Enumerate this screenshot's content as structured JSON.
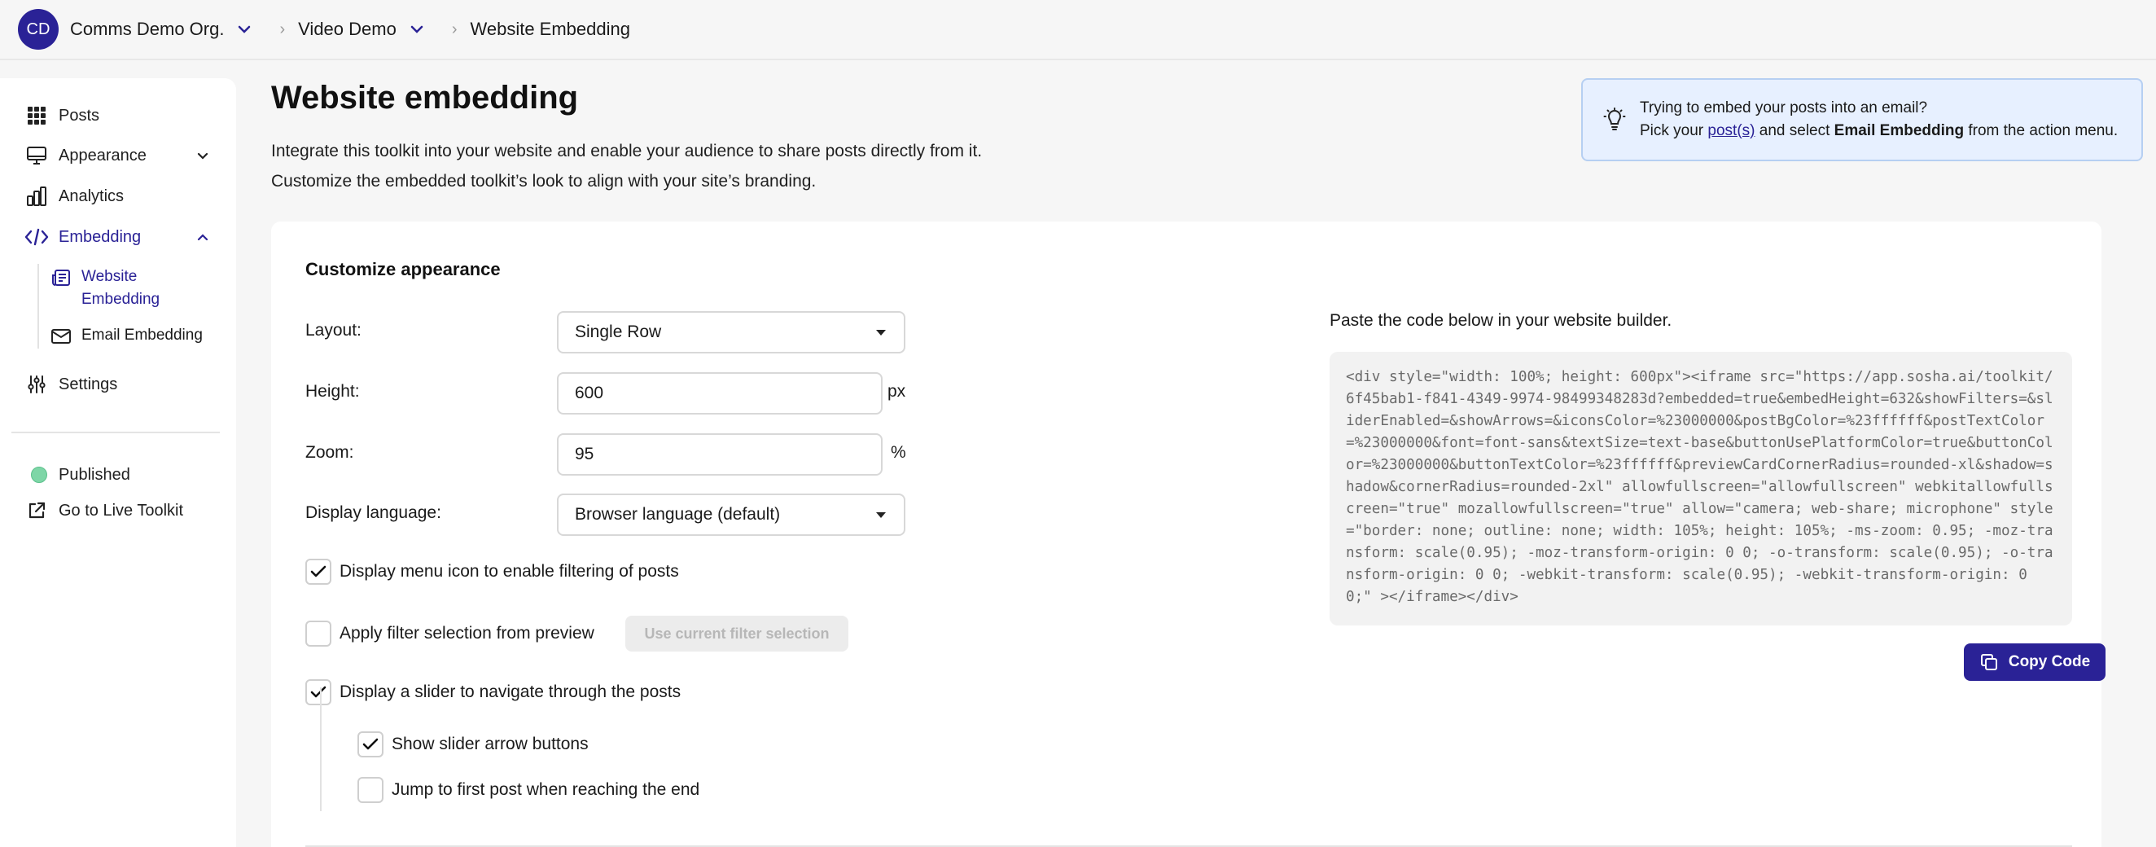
{
  "topbar": {
    "avatar": "CD",
    "org": "Comms Demo Org.",
    "project": "Video Demo",
    "current": "Website Embedding"
  },
  "sidebar": {
    "items": [
      {
        "label": "Posts",
        "icon": "grid-icon"
      },
      {
        "label": "Appearance",
        "icon": "monitor-icon"
      },
      {
        "label": "Analytics",
        "icon": "bar-chart-icon"
      },
      {
        "label": "Embedding",
        "icon": "code-icon"
      },
      {
        "label": "Settings",
        "icon": "sliders-icon"
      }
    ],
    "subitems": [
      {
        "label": "Website Embedding",
        "icon": "newspaper-icon"
      },
      {
        "label": "Email Embedding",
        "icon": "mail-icon"
      }
    ],
    "status": "Published",
    "live_link": "Go to Live Toolkit"
  },
  "main": {
    "title": "Website embedding",
    "desc1": "Integrate this toolkit into your website and enable your audience to share posts directly from it.",
    "desc2": "Customize the embedded toolkit’s look to align with your site’s branding."
  },
  "tip": {
    "line1": "Trying to embed your posts into an email?",
    "pre": "Pick your ",
    "link": "post(s)",
    "mid": " and select ",
    "bold": "Email Embedding",
    "post": " from the action menu."
  },
  "card": {
    "title": "Customize appearance",
    "layout_label": "Layout:",
    "layout_value": "Single Row",
    "height_label": "Height:",
    "height_value": "600",
    "height_unit": "px",
    "zoom_label": "Zoom:",
    "zoom_value": "95",
    "zoom_unit": "%",
    "language_label": "Display language:",
    "language_value": "Browser language (default)",
    "opt_menu_icon": "Display menu icon to enable filtering of posts",
    "opt_menu_icon_checked": true,
    "opt_apply_filter": "Apply filter selection from preview",
    "opt_apply_filter_checked": false,
    "use_filter_button": "Use current filter selection",
    "opt_slider": "Display a slider to navigate through the posts",
    "opt_slider_checked": true,
    "opt_arrows": "Show slider arrow buttons",
    "opt_arrows_checked": true,
    "opt_jump": "Jump to first post when reaching the end",
    "opt_jump_checked": false,
    "code_label": "Paste the code below in your website builder.",
    "code": "<div style=\"width: 100%; height: 600px\"><iframe src=\"https://app.sosha.ai/toolkit/6f45bab1-f841-4349-9974-98499348283d?embedded=true&embedHeight=632&showFilters=&sliderEnabled=&showArrows=&iconsColor=%23000000&postBgColor=%23ffffff&postTextColor=%23000000&font=font-sans&textSize=text-base&buttonUsePlatformColor=true&buttonColor=%23000000&buttonTextColor=%23ffffff&previewCardCornerRadius=rounded-xl&shadow=shadow&cornerRadius=rounded-2xl\" allowfullscreen=\"allowfullscreen\" webkitallowfullscreen=\"true\" mozallowfullscreen=\"true\" allow=\"camera; web-share; microphone\" style=\"border: none; outline: none; width: 105%; height: 105%; -ms-zoom: 0.95; -moz-transform: scale(0.95); -moz-transform-origin: 0 0; -o-transform: scale(0.95); -o-transform-origin: 0 0; -webkit-transform: scale(0.95); -webkit-transform-origin: 0 0;\" ></iframe></div>",
    "copy_button": "Copy Code"
  },
  "colors": {
    "accent": "#2a2296",
    "published": "#7ed6a7",
    "tip_bg": "#e7f0ff"
  }
}
